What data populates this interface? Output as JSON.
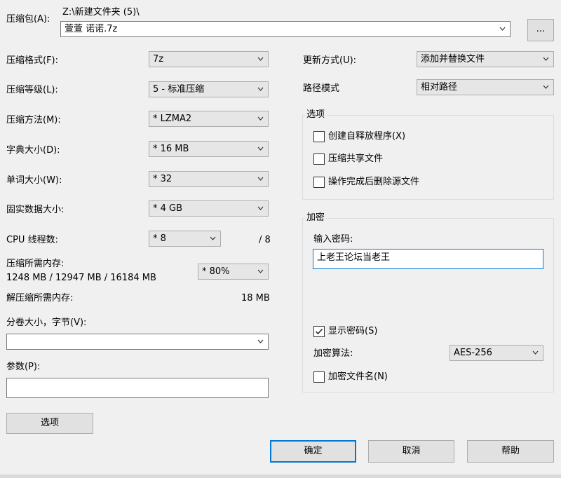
{
  "archive": {
    "label": "压缩包(A):",
    "path": "Z:\\新建文件夹 (5)\\",
    "filename": "萱萱 诺诺.7z",
    "browse_label": "..."
  },
  "left": {
    "format": {
      "label": "压缩格式(F):",
      "value": "7z"
    },
    "level": {
      "label": "压缩等级(L):",
      "value": "5 - 标准压缩"
    },
    "method": {
      "label": "压缩方法(M):",
      "value": "*  LZMA2"
    },
    "dict": {
      "label": "字典大小(D):",
      "value": "*  16 MB"
    },
    "word": {
      "label": "单词大小(W):",
      "value": "*  32"
    },
    "solid": {
      "label": "固实数据大小:",
      "value": "*  4 GB"
    },
    "threads": {
      "label": "CPU 线程数:",
      "value": "*  8",
      "max": "/ 8"
    },
    "mem_compress": {
      "label": "压缩所需内存:",
      "detail": "1248 MB / 12947 MB / 16184 MB",
      "value": "*  80%"
    },
    "mem_decompress": {
      "label": "解压缩所需内存:",
      "value": "18 MB"
    },
    "volume": {
      "label": "分卷大小，字节(V):",
      "value": ""
    },
    "params": {
      "label": "参数(P):",
      "value": ""
    },
    "options_button": "选项"
  },
  "right": {
    "update": {
      "label": "更新方式(U):",
      "value": "添加并替换文件"
    },
    "pathmode": {
      "label": "路径模式",
      "value": "相对路径"
    },
    "options": {
      "title": "选项",
      "sfx": {
        "label": "创建自释放程序(X)",
        "checked": false
      },
      "shared": {
        "label": "压缩共享文件",
        "checked": false
      },
      "delete": {
        "label": "操作完成后删除源文件",
        "checked": false
      }
    },
    "encryption": {
      "title": "加密",
      "password_label": "输入密码:",
      "password_value": "上老王论坛当老王",
      "show_password": {
        "label": "显示密码(S)",
        "checked": true
      },
      "method": {
        "label": "加密算法:",
        "value": "AES-256"
      },
      "encrypt_names": {
        "label": "加密文件名(N)",
        "checked": false
      }
    }
  },
  "footer": {
    "ok": "确定",
    "cancel": "取消",
    "help": "帮助"
  }
}
